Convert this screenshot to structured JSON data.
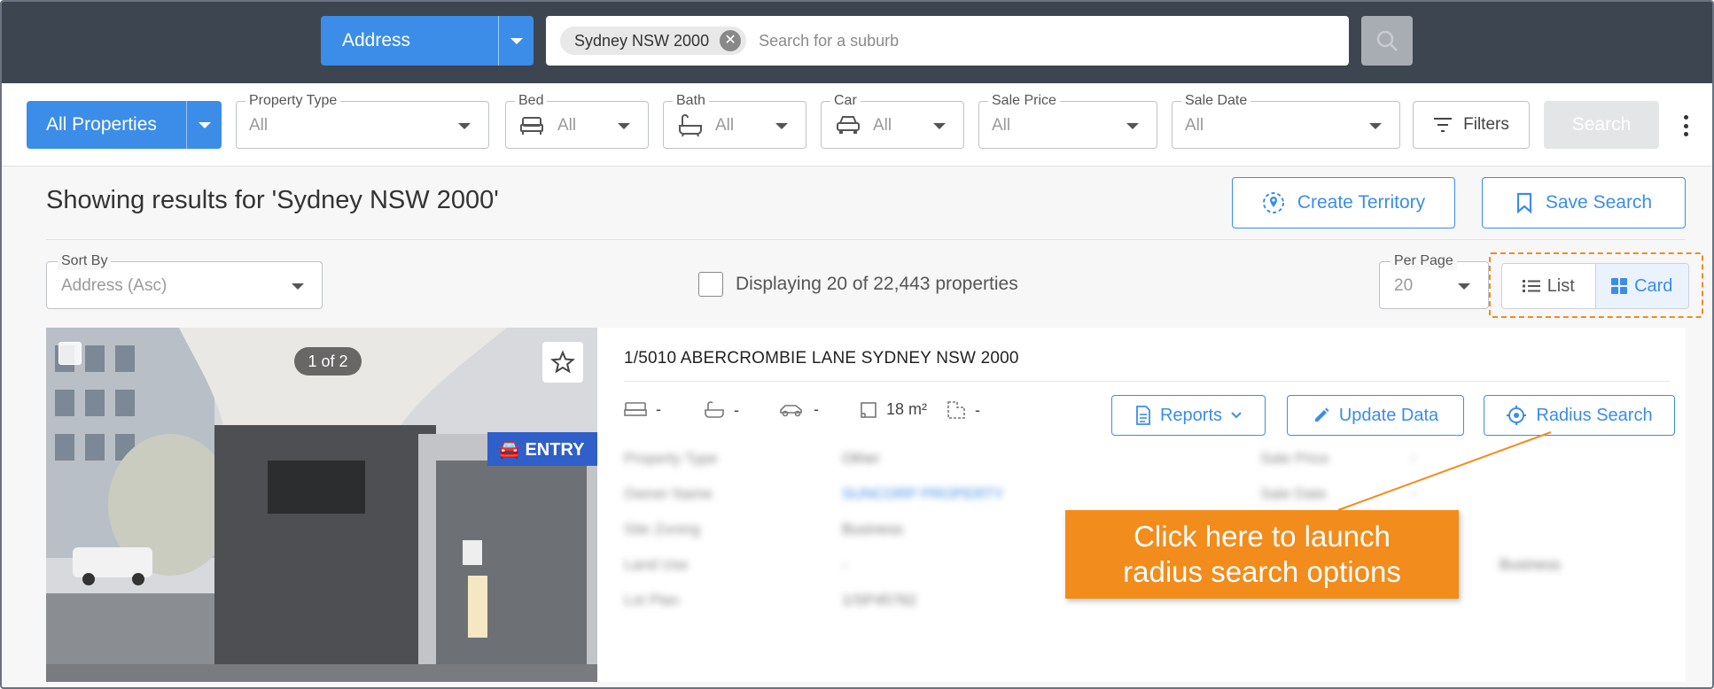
{
  "topbar": {
    "search_type": "Address",
    "chip_label": "Sydney NSW 2000",
    "chip_remove": "✕",
    "search_placeholder": "Search for a suburb"
  },
  "filters": {
    "all_properties": "All Properties",
    "property_type": {
      "label": "Property Type",
      "value": "All"
    },
    "bed": {
      "label": "Bed",
      "value": "All"
    },
    "bath": {
      "label": "Bath",
      "value": "All"
    },
    "car": {
      "label": "Car",
      "value": "All"
    },
    "sale_price": {
      "label": "Sale Price",
      "value": "All"
    },
    "sale_date": {
      "label": "Sale Date",
      "value": "All"
    },
    "filters_label": "Filters",
    "search_label": "Search"
  },
  "results": {
    "title": "Showing results for 'Sydney NSW 2000'",
    "create_territory": "Create Territory",
    "save_search": "Save Search",
    "sort_by": {
      "label": "Sort By",
      "value": "Address (Asc)"
    },
    "displaying": "Displaying 20 of 22,443 properties",
    "per_page": {
      "label": "Per Page",
      "value": "20"
    },
    "view_list": "List",
    "view_card": "Card"
  },
  "card": {
    "pager": "1 of 2",
    "address": "1/5010 ABERCROMBIE LANE SYDNEY NSW 2000",
    "beds": "-",
    "baths": "-",
    "cars": "-",
    "area": "18 m²",
    "land": "-",
    "reports": "Reports",
    "update_data": "Update Data",
    "radius_search": "Radius Search",
    "details": {
      "left_labels": [
        "Property Type",
        "Owner Name",
        "Site Zoning",
        "Land Use",
        "Lot Plan"
      ],
      "left_values": [
        "Other",
        "SUNCORP PROPERTY",
        "Business",
        "-",
        "1/SP45762"
      ],
      "right_labels": [
        "Sale Price",
        "Sale Date"
      ],
      "right_values": [
        "-",
        "-"
      ],
      "extra_right": "Business"
    }
  },
  "callout": {
    "line1": "Click here to launch",
    "line2": "radius search options"
  },
  "colors": {
    "accent": "#3b8de8",
    "topbar": "#3d4550",
    "callout": "#f28c1c"
  }
}
